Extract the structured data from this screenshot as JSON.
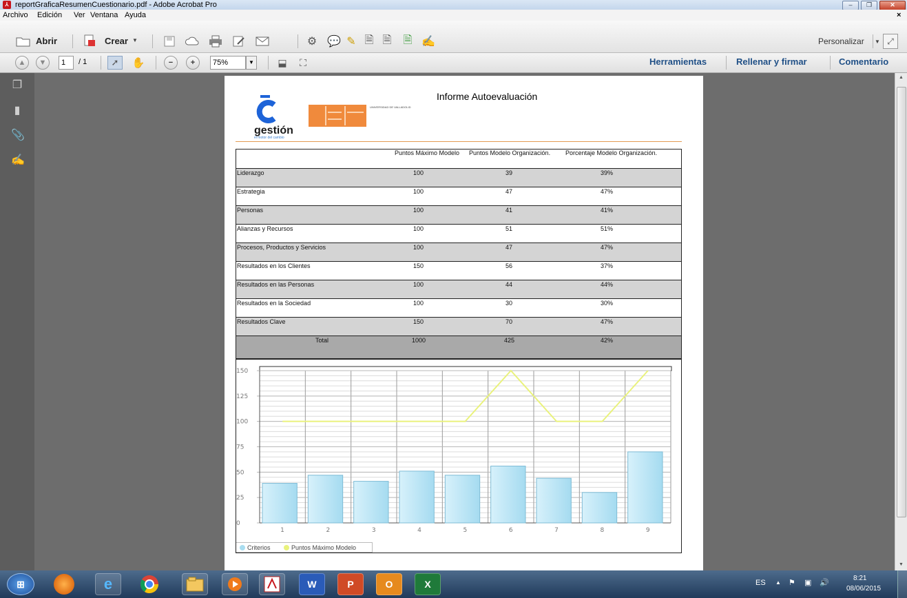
{
  "window": {
    "title": "reportGraficaResumenCuestionario.pdf - Adobe Acrobat Pro",
    "app_icon": "acrobat-icon"
  },
  "menu": [
    "Archivo",
    "Edición",
    "Ver",
    "Ventana",
    "Ayuda"
  ],
  "toolbar1": {
    "open_label": "Abrir",
    "create_label": "Crear",
    "customize_label": "Personalizar"
  },
  "toolbar2": {
    "page_current": "1",
    "page_total": "/ 1",
    "zoom": "75%",
    "tools_label": "Herramientas",
    "fill_sign_label": "Rellenar y firmar",
    "comment_label": "Comentario"
  },
  "report": {
    "title": "Informe Autoevaluación",
    "logo_text": "gestión",
    "logo_subtext": "el motor del cambio",
    "university_text": "UNIVERSIDAD DE VALLADOLID",
    "headers": [
      "Puntos Máximo Modelo",
      "Puntos Modelo Organización.",
      "Porcentaje  Modelo Organización."
    ],
    "rows": [
      {
        "name": "Liderazgo",
        "max": "100",
        "org": "39",
        "pct": "39%"
      },
      {
        "name": "Estrategia",
        "max": "100",
        "org": "47",
        "pct": "47%"
      },
      {
        "name": "Personas",
        "max": "100",
        "org": "41",
        "pct": "41%"
      },
      {
        "name": "Alianzas y Recursos",
        "max": "100",
        "org": "51",
        "pct": "51%"
      },
      {
        "name": "Procesos, Productos y Servicios",
        "max": "100",
        "org": "47",
        "pct": "47%"
      },
      {
        "name": "Resultados en los Clientes",
        "max": "150",
        "org": "56",
        "pct": "37%"
      },
      {
        "name": "Resultados en las Personas",
        "max": "100",
        "org": "44",
        "pct": "44%"
      },
      {
        "name": "Resultados en la Sociedad",
        "max": "100",
        "org": "30",
        "pct": "30%"
      },
      {
        "name": "Resultados Clave",
        "max": "150",
        "org": "70",
        "pct": "47%"
      }
    ],
    "total": {
      "name": "Total",
      "max": "1000",
      "org": "425",
      "pct": "42%"
    }
  },
  "chart_data": {
    "type": "bar",
    "categories": [
      "1",
      "2",
      "3",
      "4",
      "5",
      "6",
      "7",
      "8",
      "9"
    ],
    "series": [
      {
        "name": "Criterios",
        "type": "bar",
        "values": [
          39,
          47,
          41,
          51,
          47,
          56,
          44,
          30,
          70
        ],
        "color": "#a9ddf0"
      },
      {
        "name": "Puntos Máximo Modelo",
        "type": "line",
        "values": [
          100,
          100,
          100,
          100,
          100,
          150,
          100,
          100,
          150
        ],
        "color": "#e9f27c"
      }
    ],
    "yticks": [
      "0",
      "25",
      "50",
      "75",
      "100",
      "125",
      "150"
    ],
    "ylim": [
      0,
      150
    ],
    "grid": true,
    "legend": "bottom-left"
  },
  "taskbar": {
    "lang": "ES",
    "time": "8:21",
    "date": "08/06/2015"
  },
  "colors": {
    "link_blue": "#1f4f86",
    "row_gray": "#d4d4d4",
    "total_gray": "#a9a9a9"
  }
}
